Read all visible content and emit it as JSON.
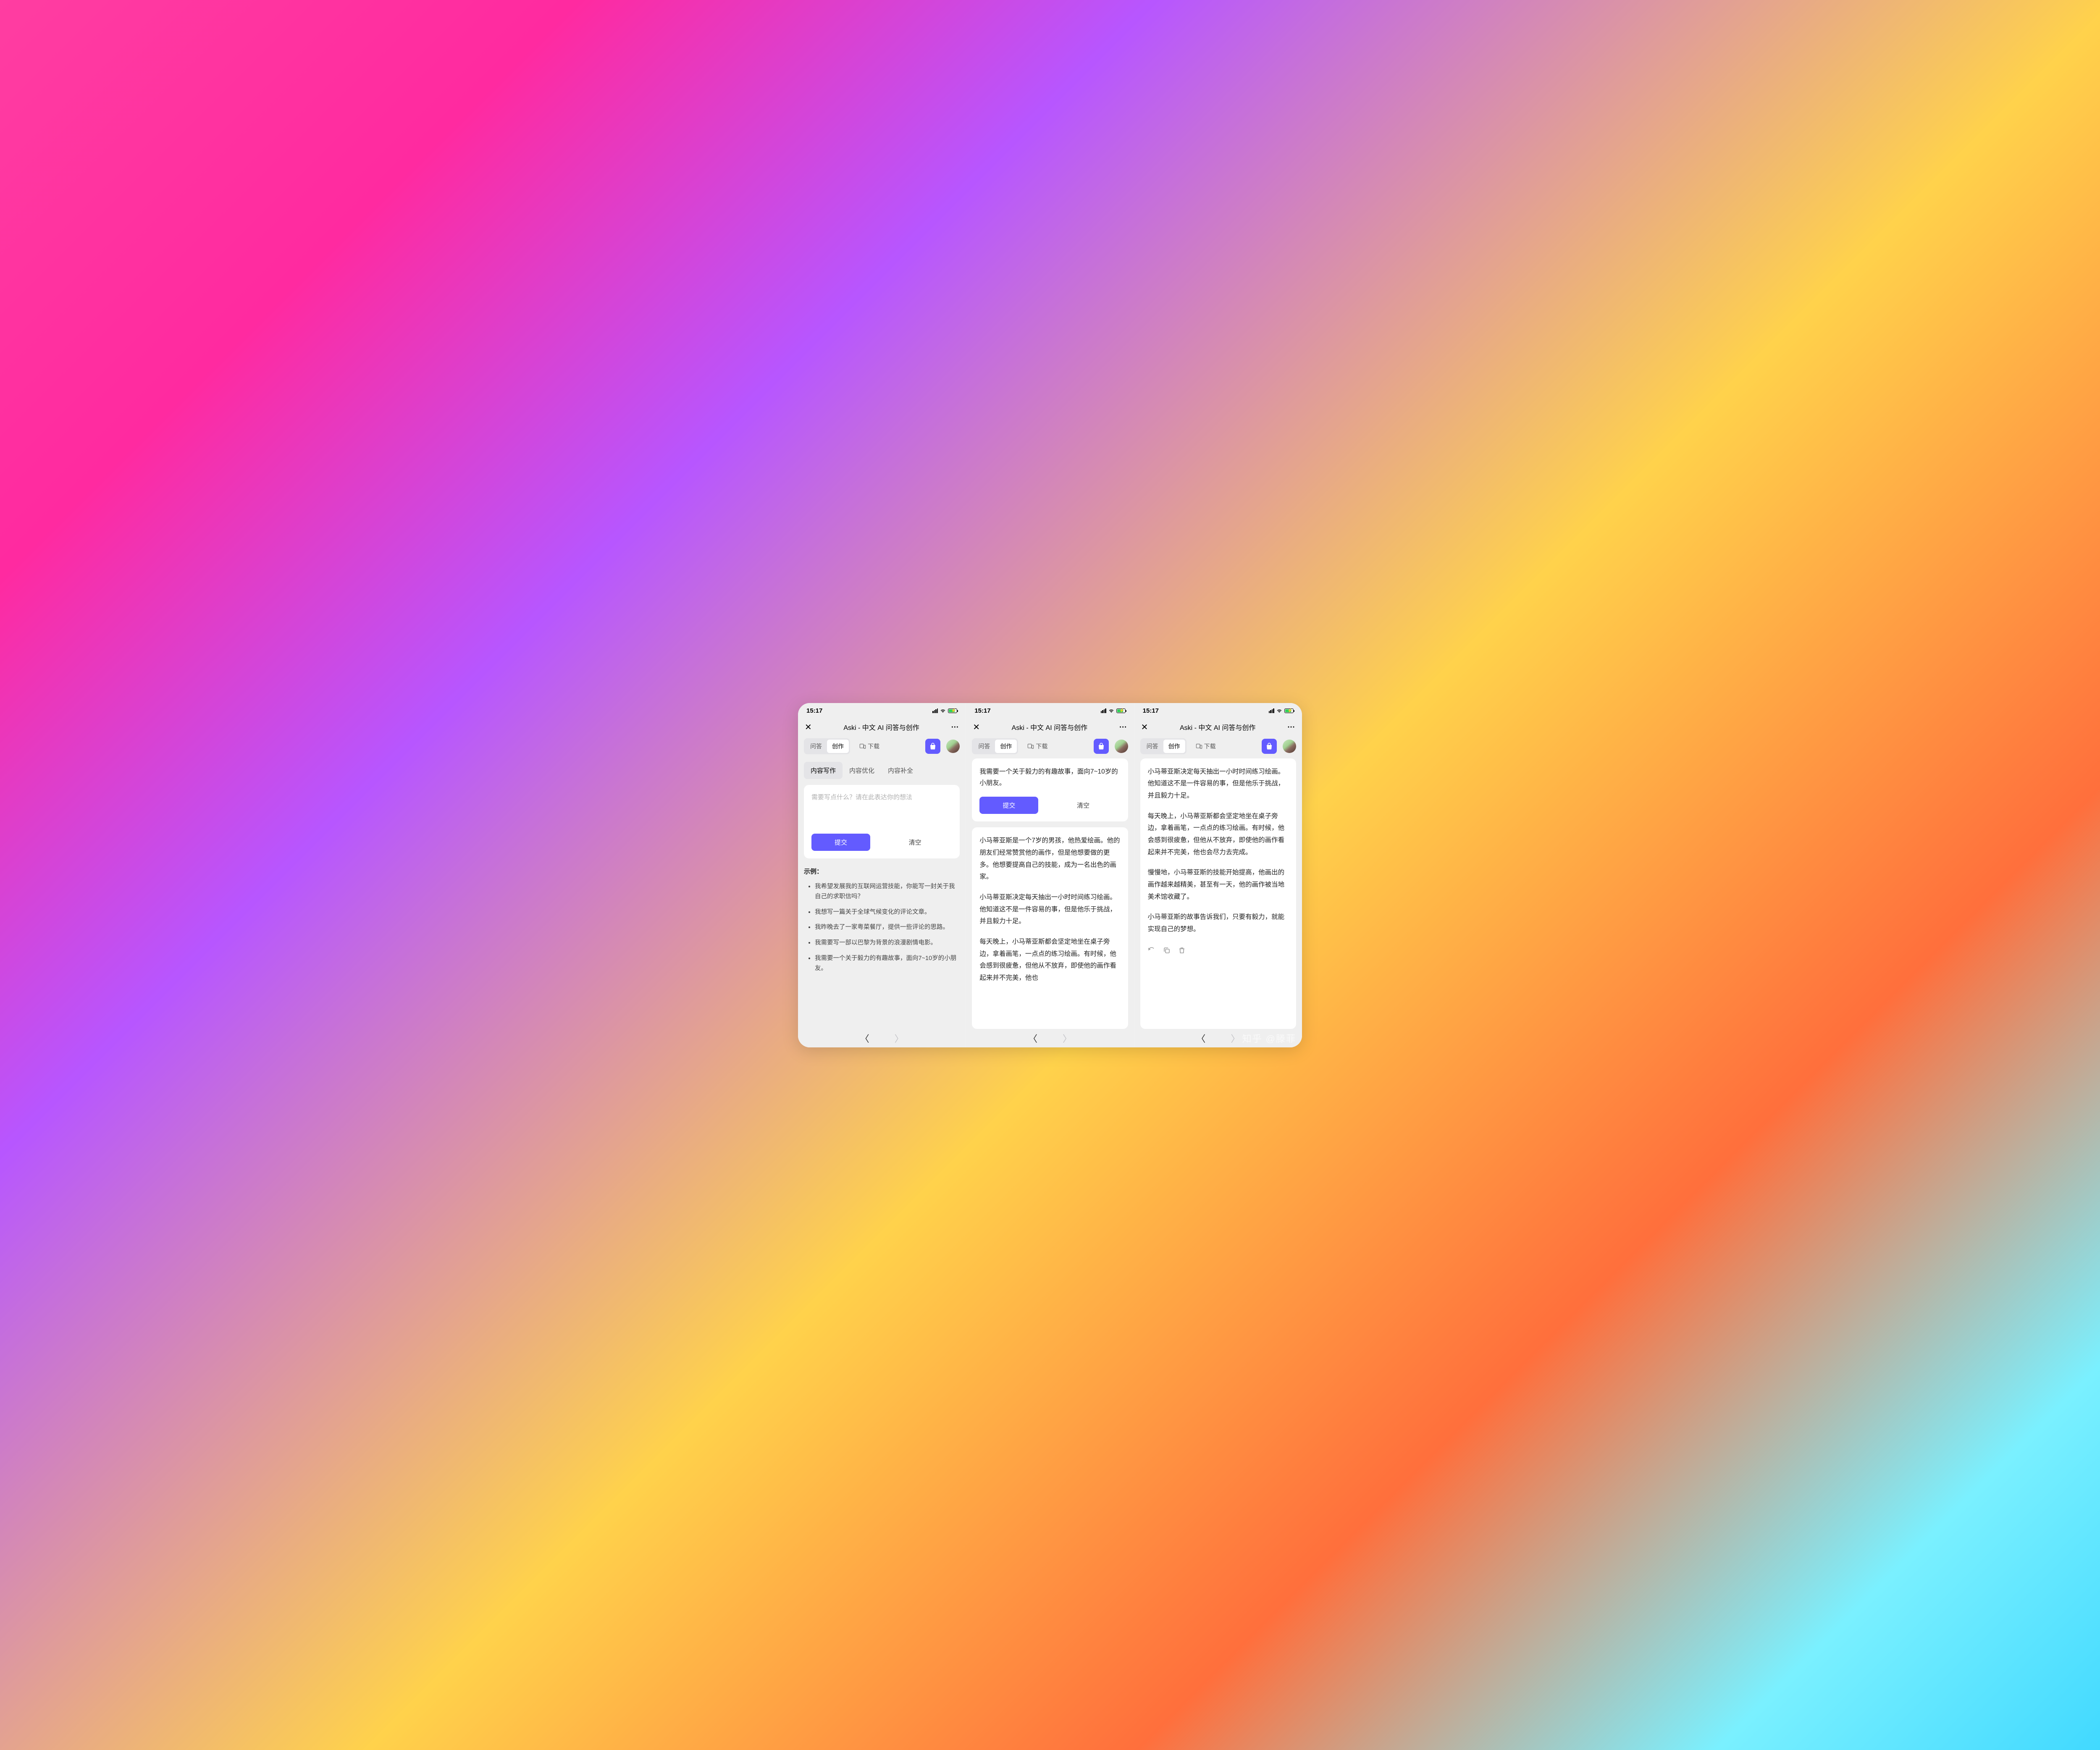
{
  "status": {
    "time": "15:17"
  },
  "title": "Aski - 中文 AI 问答与创作",
  "toolbar": {
    "qa": "问答",
    "create": "创作",
    "download": "下载"
  },
  "subtabs": {
    "write": "内容写作",
    "optimize": "内容优化",
    "complete": "内容补全"
  },
  "compose": {
    "placeholder": "需要写点什么？请在此表达你的想法",
    "submit": "提交",
    "clear": "清空",
    "user_text": "我需要一个关于毅力的有趣故事，面向7~10岁的小朋友。"
  },
  "examples": {
    "title": "示例：",
    "items": [
      "我希望发展我的互联网运营技能，你能写一封关于我自己的求职信吗？",
      "我想写一篇关于全球气候变化的评论文章。",
      "我昨晚去了一家粤菜餐厅，提供一些评论的思路。",
      "我需要写一部以巴黎为背景的浪漫剧情电影。",
      "我需要一个关于毅力的有趣故事，面向7~10岁的小朋友。"
    ]
  },
  "story": {
    "p1": "小马蒂亚斯是一个7岁的男孩，他热爱绘画。他的朋友们经常赞赏他的画作，但是他想要做的更多。他想要提高自己的技能，成为一名出色的画家。",
    "p2": "小马蒂亚斯决定每天抽出一小时时间练习绘画。他知道这不是一件容易的事，但是他乐于挑战，并且毅力十足。",
    "p3": "每天晚上，小马蒂亚斯都会坚定地坐在桌子旁边，拿着画笔，一点点的练习绘画。有时候，他会感到很疲惫，但他从不放弃，即使他的画作看起来并不完美，他也会尽力去完成。",
    "p3_cut": "每天晚上，小马蒂亚斯都会坚定地坐在桌子旁边，拿着画笔，一点点的练习绘画。有时候，他会感到很疲惫，但他从不放弃，即使他的画作看起来并不完美，他也",
    "p4": "慢慢地，小马蒂亚斯的技能开始提高，他画出的画作越来越精美，甚至有一天，他的画作被当地美术馆收藏了。",
    "p5": "小马蒂亚斯的故事告诉我们，只要有毅力，就能实现自己的梦想。"
  },
  "watermark": "知乎 @滕菲"
}
